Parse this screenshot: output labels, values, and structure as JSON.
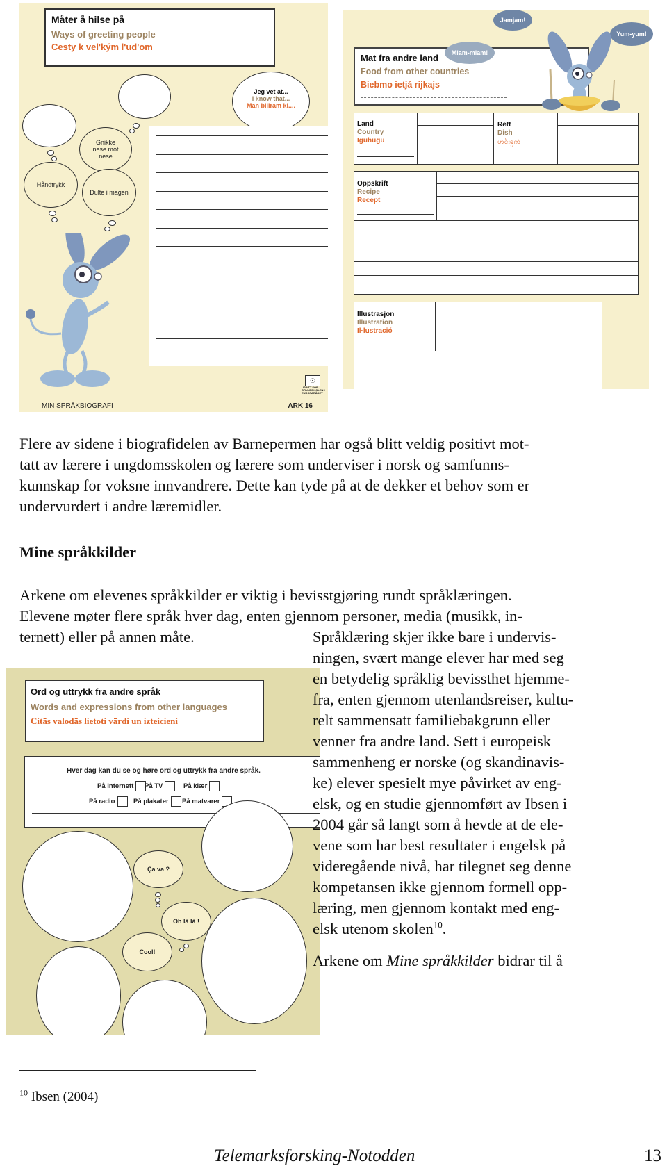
{
  "worksheet_greetings": {
    "title_no": "Måter å hilse på",
    "title_en": "Ways of greeting people",
    "title_sk": "Cesty k vel'kým l'ud'om",
    "bubbles": {
      "know_that_no": "Jeg vet at...",
      "know_that_en": "I know that...",
      "know_that_other": "Man biliram ki....",
      "nose": "Gnikke nese mot nese",
      "handshake": "Håndtrykk",
      "belly": "Dulte i magen"
    },
    "footer_left": "MIN SPRÅKBIOGRAFI",
    "footer_right": "ARK 16",
    "logo_text": "UTGITT FOR GRUNNSKOLEN I EUROPARÅDET"
  },
  "worksheet_food": {
    "title_no": "Mat fra andre land",
    "title_en": "Food from other countries",
    "title_other": "Biebmo ietjá rijkajs",
    "speech": [
      "Jamjam!",
      "Yum-yum!",
      "Miam-miam!"
    ],
    "country_no": "Land",
    "country_en": "Country",
    "country_other": "Iguhugu",
    "dish_no": "Rett",
    "dish_en": "Dish",
    "dish_other": "ဟင်းခွက်",
    "recipe_no": "Oppskrift",
    "recipe_en": "Recipe",
    "recipe_other": "Recept",
    "illustration_no": "Illustrasjon",
    "illustration_en": "Illustration",
    "illustration_other": "Il·lustració"
  },
  "body": {
    "para1": "Flere av sidene i biografidelen av Barnepermen har også blitt veldig positivt mottatt av lærere i ungdomsskolen og lærere som underviser i norsk og samfunnskunnskap for voksne innvandrere. Dette kan tyde på at de dekker et behov som er undervurdert i andre læremidler.",
    "para1_lines": [
      "Flere av sidene i biografidelen av Barnepermen har også blitt veldig positivt mot-",
      "tatt av lærere i ungdomsskolen og lærere som underviser i norsk og samfunns-",
      "kunnskap for voksne innvandrere. Dette kan tyde på at de dekker et behov som er",
      "undervurdert i andre læremidler."
    ],
    "heading": "Mine språkkilder",
    "para2_lines": [
      "Arkene om elevenes språkkilder er viktig i bevisstgjøring rundt språklæringen.",
      "Elevene møter flere språk hver dag, enten gjennom personer, media (musikk, in-",
      "ternett) eller på annen måte."
    ],
    "para3_lines": [
      "Språklæring skjer ikke bare i undervis-",
      "ningen, svært mange elever har med seg",
      "en betydelig språklig bevissthet hjemme-",
      "fra, enten gjennom utenlandsreiser, kultu-",
      "relt sammensatt familiebakgrunn eller",
      "venner fra andre land. Sett i europeisk",
      "sammenheng er norske (og skandinavis-",
      "ke) elever spesielt mye påvirket av eng-",
      "elsk, og en studie gjennomført av Ibsen i",
      "2004 går så langt som å hevde at de ele-",
      "vene som har best resultater i engelsk på",
      "videregående nivå, har tilegnet seg denne",
      "kompetansen ikke gjennom formell opp-",
      "læring, men gjennom kontakt med eng-",
      "elsk utenom skolen"
    ],
    "para3_footnote_ref": "10",
    "para3_end": ".",
    "para4_prefix": "Arkene om ",
    "para4_italic": "Mine språkkilder",
    "para4_suffix": " bidrar til å"
  },
  "worksheet_sources": {
    "title_no": "Ord og uttrykk fra andre språk",
    "title_en": "Words and expressions from other languages",
    "title_other": "Citās valodās lietoti vārdi un izteicieni",
    "prompt": "Hver dag kan du se og høre ord og uttrykk fra andre språk.",
    "options": [
      "På Internett",
      "På TV",
      "På klær",
      "På radio",
      "På plakater",
      "På matvarer"
    ],
    "bubbles": [
      "Ça va ?",
      "Oh là là !",
      "Cool!"
    ]
  },
  "footnote": {
    "number": "10",
    "text": " Ibsen (2004)"
  },
  "footer": {
    "publisher": "Telemarksforsking-Notodden",
    "page_number": "13"
  }
}
